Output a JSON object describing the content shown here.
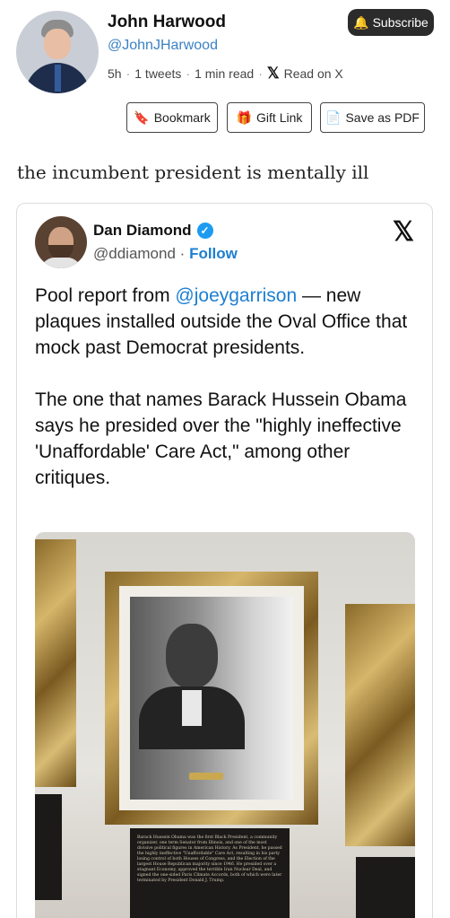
{
  "author": {
    "name": "John Harwood",
    "handle": "@JohnJHarwood",
    "time": "5h",
    "tweets": "1 tweets",
    "read_time": "1 min read",
    "read_on": "Read on X"
  },
  "subscribe_label": "Subscribe",
  "actions": {
    "bookmark": "Bookmark",
    "gift": "Gift Link",
    "pdf": "Save as PDF"
  },
  "post_text": "the incumbent president is mentally ill",
  "embedded_tweet": {
    "name": "Dan Diamond",
    "handle": "@ddiamond",
    "follow": "Follow",
    "mention": "@joeygarrison",
    "para1_prefix": "Pool report from ",
    "para1_suffix": " — new plaques installed outside the Oval Office that mock past Democrat presidents.",
    "para2": "The one that names Barack Hussein Obama says he presided over the \"highly ineffective 'Unaffordable' Care Act,\" among other critiques."
  },
  "plaque_text": "Barack Hussein Obama was the first Black President, a community organizer, one term Senator from Illinois, and one of the most divisive political figures in American History. As President, he passed the highly ineffective \"Unaffordable\" Care Act, resulting in his party losing control of both Houses of Congress, and the Election of the largest House Republican majority since 1946. He presided over a stagnant Economy, approved the terrible Iran Nuclear Deal, and signed the one-sided Paris Climate Accords, both of which were later terminated by President Donald J. Trump."
}
